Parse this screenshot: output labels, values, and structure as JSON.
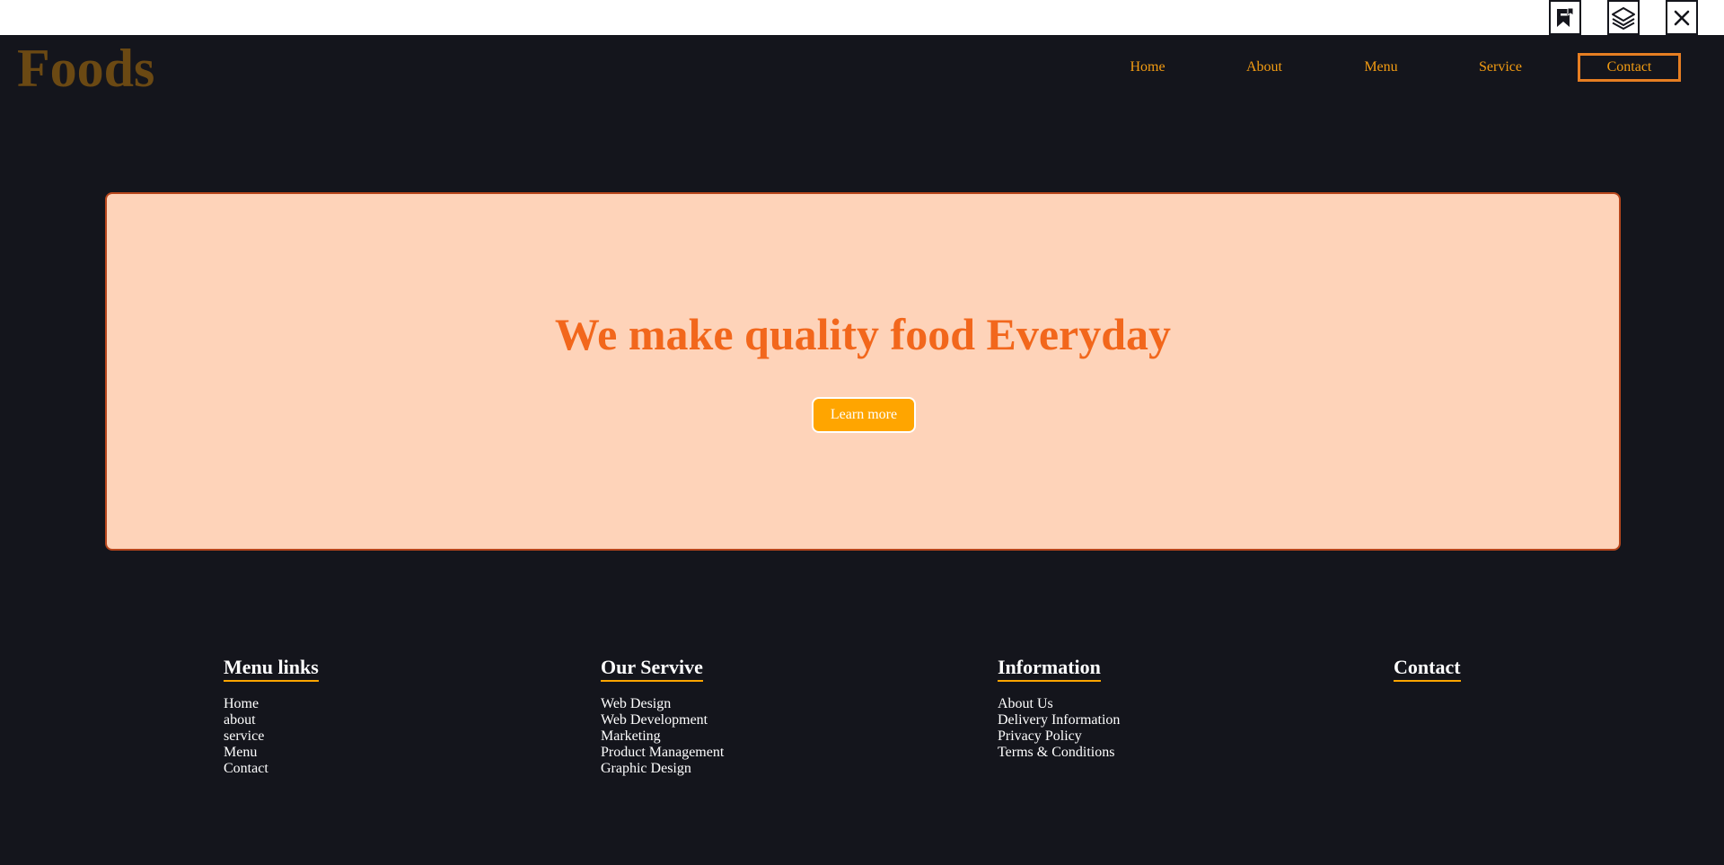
{
  "toolbar": {
    "icons": [
      "bookmark-icon",
      "layers-icon",
      "close-icon"
    ]
  },
  "nav": {
    "logo": "Foods",
    "links": [
      "Home",
      "About",
      "Menu",
      "Service",
      "Contact"
    ]
  },
  "hero": {
    "title": "We make quality food Everyday",
    "button_label": "Learn more"
  },
  "footer": {
    "columns": [
      {
        "heading": "Menu links",
        "links": [
          "Home",
          "about",
          "service",
          "Menu",
          "Contact"
        ]
      },
      {
        "heading": "Our Servive",
        "links": [
          "Web Design",
          "Web Development",
          "Marketing",
          "Product Management",
          "Graphic Design"
        ]
      },
      {
        "heading": "Information",
        "links": [
          "About Us",
          "Delivery Information",
          "Privacy Policy",
          "Terms & Conditions"
        ]
      },
      {
        "heading": "Contact",
        "links": []
      }
    ]
  },
  "colors": {
    "background": "#14151c",
    "accent": "#ffa500",
    "nav_link": "#f39c12",
    "hero_bg": "#fed3b9",
    "hero_title": "#f2671c",
    "logo": "#6b4913"
  }
}
